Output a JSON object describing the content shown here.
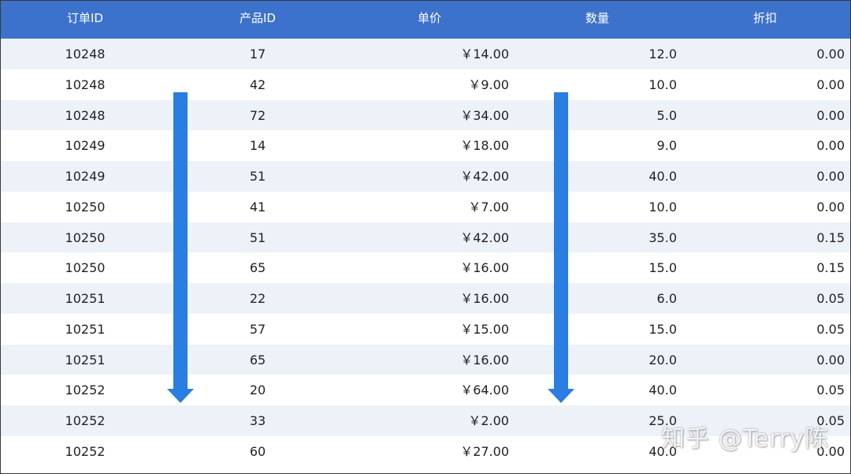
{
  "table": {
    "headers": [
      "订单ID",
      "产品ID",
      "单价",
      "数量",
      "折扣"
    ],
    "rows": [
      [
        "10248",
        "17",
        "￥14.00",
        "12.0",
        "0.00"
      ],
      [
        "10248",
        "42",
        "￥9.00",
        "10.0",
        "0.00"
      ],
      [
        "10248",
        "72",
        "￥34.00",
        "5.0",
        "0.00"
      ],
      [
        "10249",
        "14",
        "￥18.00",
        "9.0",
        "0.00"
      ],
      [
        "10249",
        "51",
        "￥42.00",
        "40.0",
        "0.00"
      ],
      [
        "10250",
        "41",
        "￥7.00",
        "10.0",
        "0.00"
      ],
      [
        "10250",
        "51",
        "￥42.00",
        "35.0",
        "0.15"
      ],
      [
        "10250",
        "65",
        "￥16.00",
        "15.0",
        "0.15"
      ],
      [
        "10251",
        "22",
        "￥16.00",
        "6.0",
        "0.05"
      ],
      [
        "10251",
        "57",
        "￥15.00",
        "15.0",
        "0.05"
      ],
      [
        "10251",
        "65",
        "￥16.00",
        "20.0",
        "0.00"
      ],
      [
        "10252",
        "20",
        "￥64.00",
        "40.0",
        "0.05"
      ],
      [
        "10252",
        "33",
        "￥2.00",
        "25.0",
        "0.05"
      ],
      [
        "10252",
        "60",
        "￥27.00",
        "40.0",
        "0.00"
      ]
    ]
  },
  "colors": {
    "header_bg": "#3d72cc",
    "header_text": "#ffffff",
    "row_alt_bg": "#edf2f9",
    "arrow": "#2a7de1"
  },
  "icons": [
    "down-arrow-icon",
    "down-arrow-icon"
  ],
  "watermark": "知乎 @Terry陈"
}
